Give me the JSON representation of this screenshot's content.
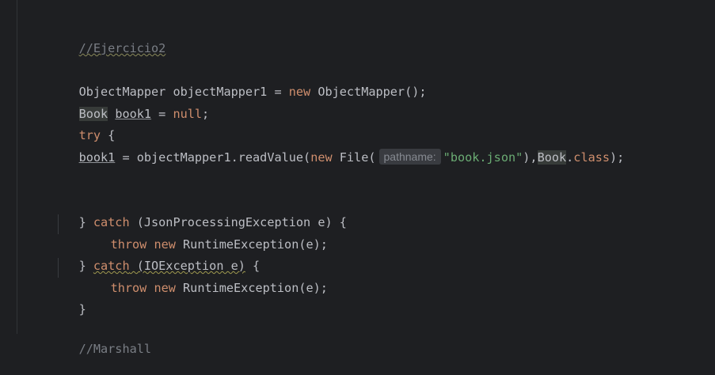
{
  "code": {
    "comment1": "//Ejercicio2",
    "l2_type": "ObjectMapper",
    "l2_var": " objectMapper1 = ",
    "l2_new": "new",
    "l2_ctor": " ObjectMapper();",
    "l3_type": "Book",
    "l3_var": "book1",
    "l3_eq": " = ",
    "l3_null": "null",
    "l3_semi": ";",
    "l4_try": "try",
    "l4_brace": " {",
    "l5_var": "book1",
    "l5_call": " = objectMapper1.readValue(",
    "l5_new": "new",
    "l5_file": " File(",
    "l5_hint": "pathname:",
    "l5_str": "\"book.json\"",
    "l5_comma": "),",
    "l5_book": "Book",
    "l5_dot": ".",
    "l5_class": "class",
    "l5_end": ");",
    "l6_close": "} ",
    "l6_catch": "catch",
    "l6_rest": " (JsonProcessingException e) {",
    "l7_throw": "throw",
    "l7_new": "new",
    "l7_rest": " RuntimeException(e);",
    "l8_close": "} ",
    "l8_catch": "catch",
    "l8_paren": " (IOException e)",
    "l8_brace": " {",
    "l9_throw": "throw",
    "l9_new": "new",
    "l9_rest": " RuntimeException(e);",
    "l10_close": "}",
    "comment2": "//Marshall"
  },
  "colors": {
    "background": "#1e1f22",
    "keyword": "#cf8e6d",
    "string": "#6aab73",
    "comment": "#7a7e85",
    "text": "#bcbec4"
  }
}
